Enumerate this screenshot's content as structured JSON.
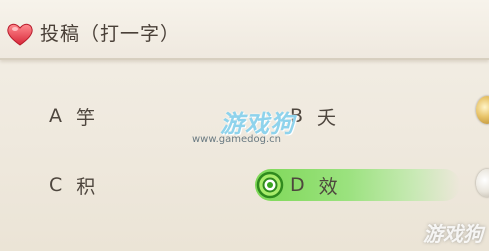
{
  "header": {
    "title": "投稿（打一字）",
    "icon": "heart-icon"
  },
  "options": [
    {
      "letter": "A",
      "text": "竽",
      "selected": false
    },
    {
      "letter": "B",
      "text": "夭",
      "selected": false
    },
    {
      "letter": "C",
      "text": "积",
      "selected": false
    },
    {
      "letter": "D",
      "text": "效",
      "selected": true
    }
  ],
  "watermark": {
    "logo_text": "游戏狗",
    "url": "www.gamedog.cn"
  },
  "corner_watermark": "游戏狗",
  "colors": {
    "selected": "#7ad650",
    "heart": "#e8404f",
    "text": "#4e463e"
  }
}
